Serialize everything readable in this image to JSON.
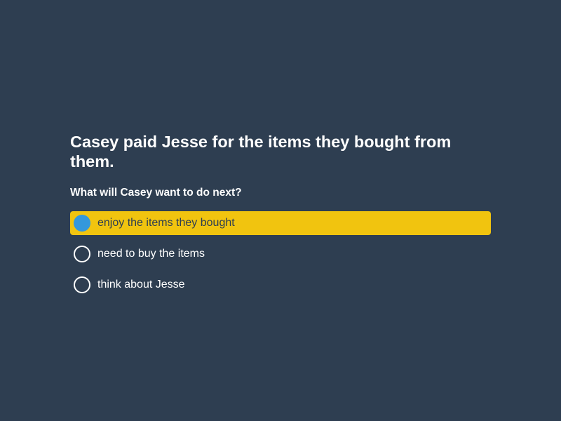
{
  "quiz": {
    "question": "Casey paid Jesse for the items they bought from them.",
    "prompt": "What will Casey want to do next?",
    "options": [
      {
        "label": "enjoy the items they bought",
        "selected": true
      },
      {
        "label": "need to buy the items",
        "selected": false
      },
      {
        "label": "think about Jesse",
        "selected": false
      }
    ]
  },
  "colors": {
    "background": "#2e3e51",
    "selected_highlight": "#f1c40f",
    "selected_radio": "#3498db",
    "text": "#ffffff"
  }
}
